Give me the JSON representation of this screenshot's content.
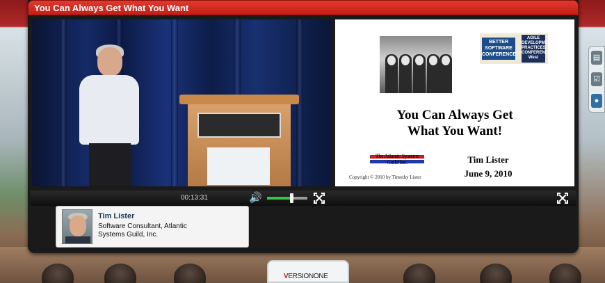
{
  "window": {
    "title": "You Can Always Get What You Want"
  },
  "slide": {
    "conference_logo_better": "BETTER SOFTWARE CONFERENCE",
    "conference_logo_agile": "AGILE DEVELOPMENT PRACTICES CONFERENCE West",
    "title_line1": "You Can Always Get",
    "title_line2": "What You Want!",
    "company_logo": "The Atlantic Systems Guild Inc.",
    "presenter": "Tim Lister",
    "date": "June 9, 2010",
    "copyright": "Copyright © 2010 by Timothy Lister"
  },
  "player": {
    "elapsed_time": "00:13:31",
    "volume_level": 0.6
  },
  "presenter_info": {
    "name": "Tim Lister",
    "role": "Software Consultant, Atlantic Systems Guild, Inc."
  },
  "sponsor": {
    "logo_text": "VERSIONONE"
  },
  "side_tools": {
    "icons": [
      "slides-icon",
      "checklist-icon",
      "people-icon"
    ]
  },
  "colors": {
    "title_bar": "#c41f16",
    "volume_fill": "#2ecc40"
  }
}
